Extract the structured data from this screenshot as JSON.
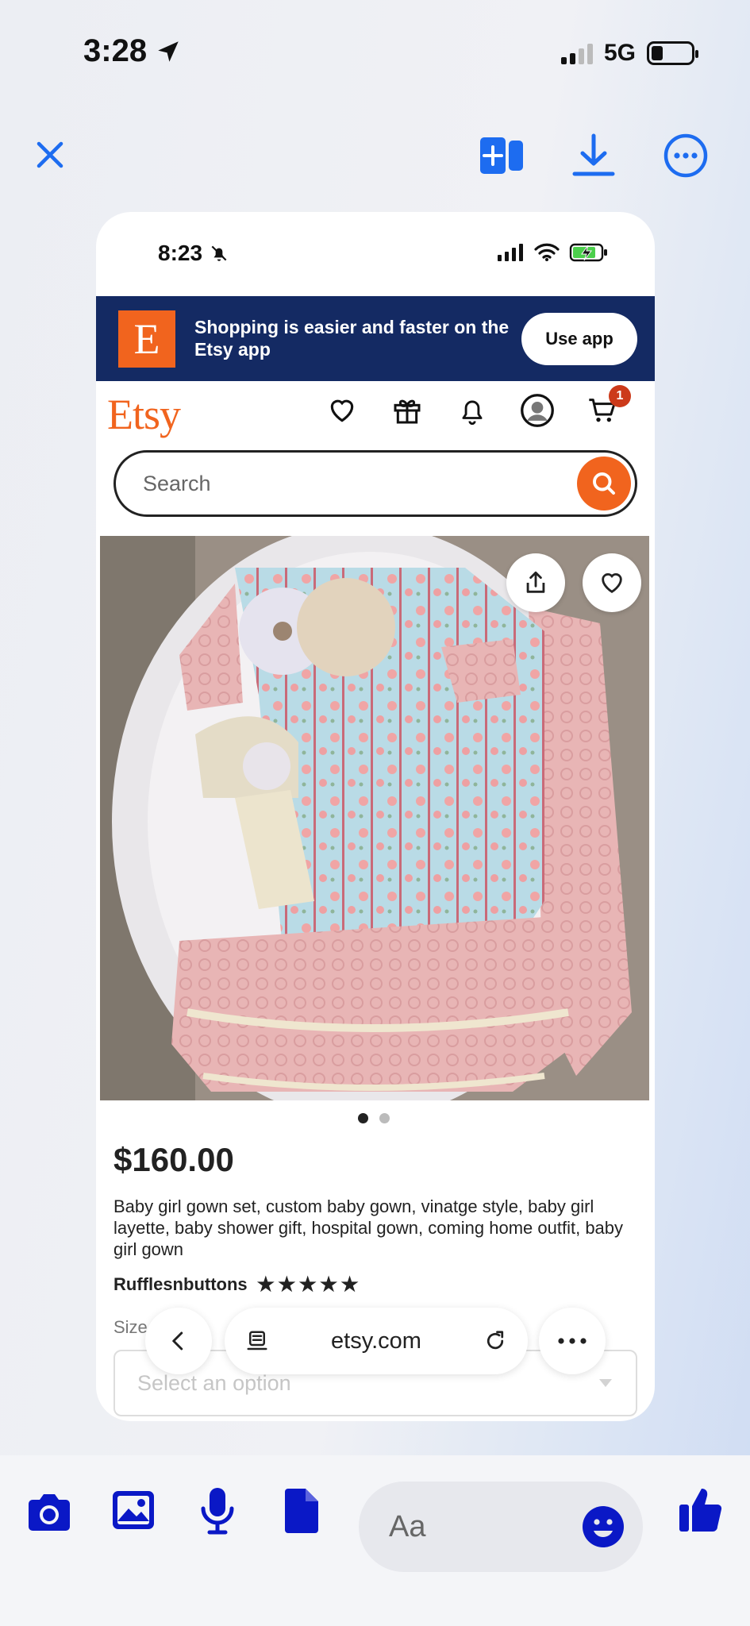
{
  "status_bar": {
    "time": "3:28",
    "network": "5G"
  },
  "top_bar": {
    "icons": [
      "close-icon",
      "add-to-panel-icon",
      "download-icon",
      "more-options-icon"
    ],
    "accent": "#1d6cf0"
  },
  "screenshot": {
    "status_bar": {
      "time": "8:23"
    },
    "banner": {
      "logo_letter": "E",
      "message": "Shopping is easier and faster on the Etsy app",
      "button_label": "Use app"
    },
    "header": {
      "logo_text": "Etsy",
      "cart_badge": "1",
      "icons": [
        "favorites-icon",
        "gift-icon",
        "notifications-icon",
        "account-icon",
        "cart-icon"
      ]
    },
    "search": {
      "placeholder": "Search"
    },
    "listing": {
      "image_slides": 2,
      "active_slide": 1,
      "price": "$160.00",
      "title": "Baby girl gown set, custom baby gown, vinatge style, baby girl layette, baby shower gift, hospital gown, coming home outfit, baby girl gown",
      "shop_name": "Rufflesnbuttons",
      "rating_stars": 5,
      "size_label": "Size",
      "size_select_placeholder": "Select an option"
    },
    "browser_bar": {
      "url": "etsy.com"
    }
  },
  "composer": {
    "placeholder": "Aa",
    "icons": [
      "camera-icon",
      "photo-icon",
      "microphone-icon",
      "document-icon",
      "emoji-icon",
      "thumbs-up-icon"
    ]
  },
  "colors": {
    "etsy_orange": "#f1641e",
    "etsy_navy": "#142a63",
    "messenger_blue": "#0a18c6"
  }
}
